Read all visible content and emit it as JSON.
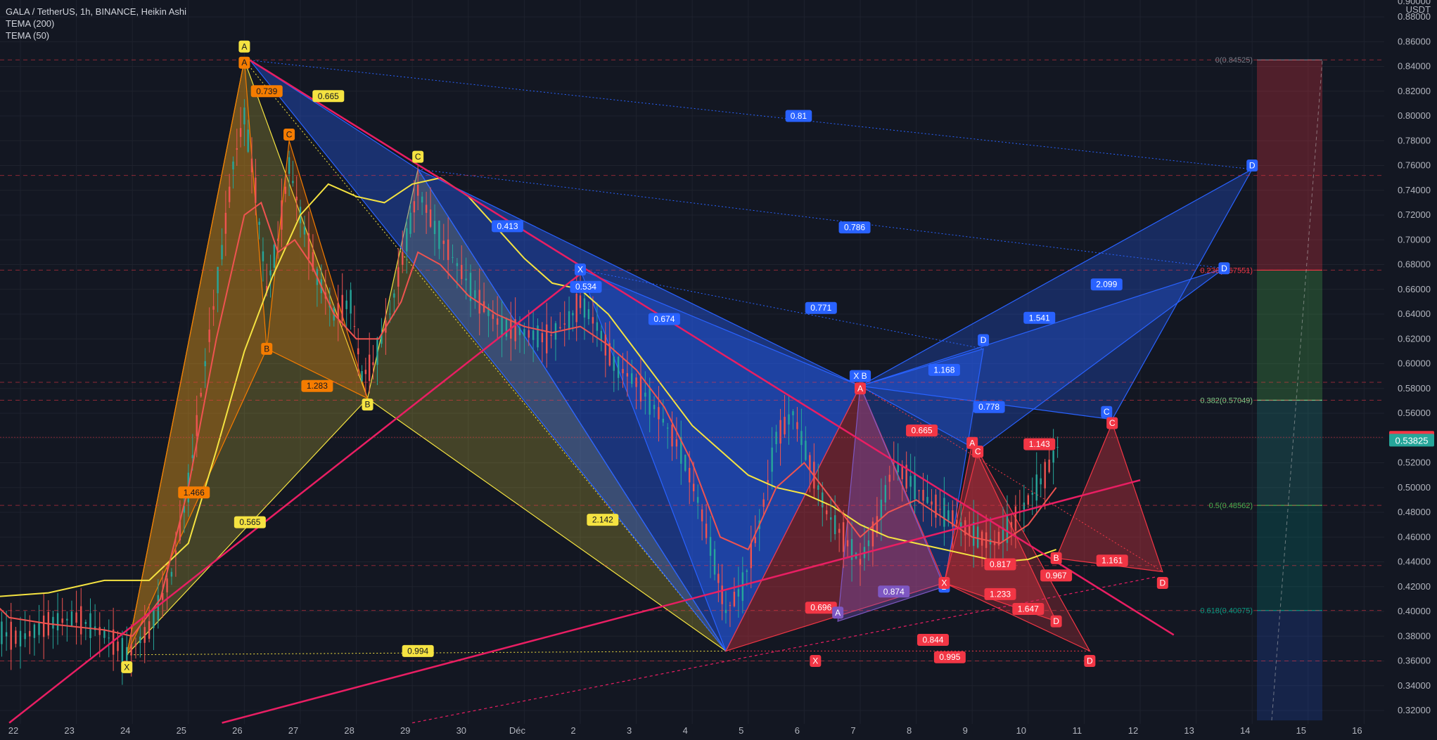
{
  "header": {
    "symbol_line": "GALA / TetherUS, 1h, BINANCE, Heikin Ashi",
    "indicators": [
      "TEMA (200)",
      "TEMA (50)"
    ]
  },
  "price_axis": {
    "unit": "USDT",
    "top_label": "0.90000",
    "ticks": [
      "0.88000",
      "0.86000",
      "0.84000",
      "0.82000",
      "0.80000",
      "0.78000",
      "0.76000",
      "0.74000",
      "0.72000",
      "0.70000",
      "0.68000",
      "0.66000",
      "0.64000",
      "0.62000",
      "0.60000",
      "0.58000",
      "0.56000",
      "0.54000",
      "0.52000",
      "0.50000",
      "0.48000",
      "0.46000",
      "0.44000",
      "0.42000",
      "0.40000",
      "0.38000",
      "0.36000",
      "0.34000",
      "0.32000"
    ],
    "current_price": "0.54060",
    "secondary_price": "0.53825",
    "current_price_color": "#f23645",
    "secondary_price_color": "#26a69a"
  },
  "time_axis": {
    "ticks": [
      "22",
      "23",
      "24",
      "25",
      "26",
      "27",
      "28",
      "29",
      "30",
      "Déc",
      "2",
      "3",
      "4",
      "5",
      "6",
      "7",
      "8",
      "9",
      "10",
      "11",
      "12",
      "13",
      "14",
      "15",
      "16"
    ]
  },
  "fib_levels": [
    {
      "label": "0(0.84525)",
      "price": 0.84525,
      "color": "#787b86"
    },
    {
      "label": "0.236(0.67551)",
      "price": 0.67551,
      "color": "#f23645"
    },
    {
      "label": "0.382(0.57049)",
      "price": 0.57049,
      "color": "#81c784"
    },
    {
      "label": "0.5(0.48562)",
      "price": 0.48562,
      "color": "#4caf50"
    },
    {
      "label": "0.618(0.40075)",
      "price": 0.40075,
      "color": "#089981"
    }
  ],
  "pattern_labels": {
    "yellow": [
      {
        "text": "A",
        "t": 26.0,
        "p": 0.856
      },
      {
        "text": "C",
        "t": 29.1,
        "p": 0.767
      },
      {
        "text": "B",
        "t": 28.2,
        "p": 0.567
      },
      {
        "text": "X",
        "t": 23.9,
        "p": 0.355
      },
      {
        "text": "0.665",
        "t": 27.5,
        "p": 0.816
      },
      {
        "text": "0.994",
        "t": 29.1,
        "p": 0.368
      },
      {
        "text": "2.142",
        "t": 32.4,
        "p": 0.474
      },
      {
        "text": "0.565",
        "t": 26.1,
        "p": 0.472
      }
    ],
    "orange": [
      {
        "text": "0.739",
        "t": 26.4,
        "p": 0.82
      },
      {
        "text": "C",
        "t": 26.8,
        "p": 0.785
      },
      {
        "text": "B",
        "t": 26.4,
        "p": 0.612
      },
      {
        "text": "1.283",
        "t": 27.3,
        "p": 0.582
      },
      {
        "text": "1.466",
        "t": 25.1,
        "p": 0.496
      },
      {
        "text": "A",
        "t": 26.0,
        "p": 0.843
      }
    ],
    "blue": [
      {
        "text": "0.81",
        "t": 35.9,
        "p": 0.8
      },
      {
        "text": "D",
        "t": 44.0,
        "p": 0.76
      },
      {
        "text": "0.413",
        "t": 30.7,
        "p": 0.711
      },
      {
        "text": "0.786",
        "t": 36.9,
        "p": 0.71
      },
      {
        "text": "D",
        "t": 43.5,
        "p": 0.677
      },
      {
        "text": "2.099",
        "t": 41.4,
        "p": 0.664
      },
      {
        "text": "X",
        "t": 32.0,
        "p": 0.676
      },
      {
        "text": "0.534",
        "t": 32.1,
        "p": 0.662
      },
      {
        "text": "0.674",
        "t": 33.5,
        "p": 0.636
      },
      {
        "text": "0.771",
        "t": 36.3,
        "p": 0.645
      },
      {
        "text": "1.541",
        "t": 40.2,
        "p": 0.637
      },
      {
        "text": "D",
        "t": 39.2,
        "p": 0.619
      },
      {
        "text": "X B",
        "t": 37.0,
        "p": 0.59
      },
      {
        "text": "1.168",
        "t": 38.5,
        "p": 0.595
      },
      {
        "text": "0.778",
        "t": 39.3,
        "p": 0.565
      },
      {
        "text": "C",
        "t": 41.4,
        "p": 0.561
      },
      {
        "text": "B",
        "t": 38.5,
        "p": 0.42
      }
    ],
    "red": [
      {
        "text": "A",
        "t": 37.0,
        "p": 0.58
      },
      {
        "text": "0.665",
        "t": 38.1,
        "p": 0.546
      },
      {
        "text": "A",
        "t": 39.0,
        "p": 0.536
      },
      {
        "text": "C",
        "t": 39.1,
        "p": 0.529
      },
      {
        "text": "1.143",
        "t": 40.2,
        "p": 0.535
      },
      {
        "text": "C",
        "t": 41.5,
        "p": 0.552
      },
      {
        "text": "X",
        "t": 38.5,
        "p": 0.423
      },
      {
        "text": "0.817",
        "t": 39.5,
        "p": 0.438
      },
      {
        "text": "B",
        "t": 40.5,
        "p": 0.443
      },
      {
        "text": "0.967",
        "t": 40.5,
        "p": 0.429
      },
      {
        "text": "1.161",
        "t": 41.5,
        "p": 0.441
      },
      {
        "text": "D",
        "t": 42.4,
        "p": 0.423
      },
      {
        "text": "1.233",
        "t": 39.5,
        "p": 0.414
      },
      {
        "text": "1.647",
        "t": 40.0,
        "p": 0.402
      },
      {
        "text": "D",
        "t": 40.5,
        "p": 0.392
      },
      {
        "text": "0.696",
        "t": 36.3,
        "p": 0.403
      },
      {
        "text": "0.844",
        "t": 38.3,
        "p": 0.377
      },
      {
        "text": "0.995",
        "t": 38.6,
        "p": 0.363
      },
      {
        "text": "D",
        "t": 41.1,
        "p": 0.36
      },
      {
        "text": "X",
        "t": 36.2,
        "p": 0.36
      }
    ],
    "purple": [
      {
        "text": "A",
        "t": 36.6,
        "p": 0.399
      },
      {
        "text": "0.874",
        "t": 37.6,
        "p": 0.416
      }
    ]
  },
  "colors": {
    "background": "#131722",
    "grid": "#1e222d",
    "up_candle": "#26a69a",
    "down_candle": "#ef5350",
    "tema200": "#f5e341",
    "tema50": "#ef5350",
    "trendline": "#e91e63",
    "harmonic_yellow": "#f5e341",
    "harmonic_orange": "#f57c00",
    "harmonic_blue": "#2962ff",
    "harmonic_red": "#f23645",
    "harmonic_purple": "#7e57c2"
  },
  "chart_data": {
    "type": "candlestick",
    "title": "GALA / TetherUS, 1h, BINANCE, Heikin Ashi",
    "xlabel": "",
    "ylabel": "USDT",
    "ylim": [
      0.31,
      0.9
    ],
    "x_ticks": [
      "22",
      "23",
      "24",
      "25",
      "26",
      "27",
      "28",
      "29",
      "30",
      "Déc",
      "2",
      "3",
      "4",
      "5",
      "6",
      "7",
      "8",
      "9",
      "10",
      "11",
      "12",
      "13",
      "14",
      "15",
      "16"
    ],
    "close_series": [
      {
        "t": 21.0,
        "p": 0.4
      },
      {
        "t": 21.5,
        "p": 0.385
      },
      {
        "t": 22.0,
        "p": 0.378
      },
      {
        "t": 22.5,
        "p": 0.39
      },
      {
        "t": 23.0,
        "p": 0.395
      },
      {
        "t": 23.5,
        "p": 0.382
      },
      {
        "t": 23.9,
        "p": 0.365
      },
      {
        "t": 24.3,
        "p": 0.385
      },
      {
        "t": 24.7,
        "p": 0.43
      },
      {
        "t": 25.0,
        "p": 0.5
      },
      {
        "t": 25.3,
        "p": 0.6
      },
      {
        "t": 25.6,
        "p": 0.69
      },
      {
        "t": 25.8,
        "p": 0.76
      },
      {
        "t": 26.0,
        "p": 0.8
      },
      {
        "t": 26.2,
        "p": 0.74
      },
      {
        "t": 26.4,
        "p": 0.66
      },
      {
        "t": 26.6,
        "p": 0.7
      },
      {
        "t": 26.8,
        "p": 0.76
      },
      {
        "t": 27.0,
        "p": 0.72
      },
      {
        "t": 27.3,
        "p": 0.67
      },
      {
        "t": 27.6,
        "p": 0.64
      },
      {
        "t": 27.9,
        "p": 0.65
      },
      {
        "t": 28.1,
        "p": 0.59
      },
      {
        "t": 28.3,
        "p": 0.6
      },
      {
        "t": 28.6,
        "p": 0.64
      },
      {
        "t": 28.9,
        "p": 0.7
      },
      {
        "t": 29.1,
        "p": 0.74
      },
      {
        "t": 29.4,
        "p": 0.71
      },
      {
        "t": 29.8,
        "p": 0.68
      },
      {
        "t": 30.2,
        "p": 0.65
      },
      {
        "t": 30.6,
        "p": 0.63
      },
      {
        "t": 31.0,
        "p": 0.625
      },
      {
        "t": 31.4,
        "p": 0.62
      },
      {
        "t": 31.8,
        "p": 0.635
      },
      {
        "t": 32.0,
        "p": 0.65
      },
      {
        "t": 32.3,
        "p": 0.63
      },
      {
        "t": 32.6,
        "p": 0.6
      },
      {
        "t": 33.0,
        "p": 0.585
      },
      {
        "t": 33.4,
        "p": 0.56
      },
      {
        "t": 33.8,
        "p": 0.53
      },
      {
        "t": 34.1,
        "p": 0.49
      },
      {
        "t": 34.4,
        "p": 0.44
      },
      {
        "t": 34.6,
        "p": 0.4
      },
      {
        "t": 34.9,
        "p": 0.42
      },
      {
        "t": 35.2,
        "p": 0.47
      },
      {
        "t": 35.5,
        "p": 0.54
      },
      {
        "t": 35.8,
        "p": 0.56
      },
      {
        "t": 36.1,
        "p": 0.52
      },
      {
        "t": 36.4,
        "p": 0.48
      },
      {
        "t": 36.7,
        "p": 0.46
      },
      {
        "t": 37.0,
        "p": 0.44
      },
      {
        "t": 37.3,
        "p": 0.47
      },
      {
        "t": 37.6,
        "p": 0.52
      },
      {
        "t": 37.9,
        "p": 0.505
      },
      {
        "t": 38.2,
        "p": 0.49
      },
      {
        "t": 38.5,
        "p": 0.48
      },
      {
        "t": 38.8,
        "p": 0.47
      },
      {
        "t": 39.1,
        "p": 0.46
      },
      {
        "t": 39.4,
        "p": 0.455
      },
      {
        "t": 39.7,
        "p": 0.47
      },
      {
        "t": 40.0,
        "p": 0.49
      },
      {
        "t": 40.3,
        "p": 0.51
      },
      {
        "t": 40.6,
        "p": 0.54
      }
    ],
    "tema200": [
      {
        "t": 21.0,
        "p": 0.41
      },
      {
        "t": 22.5,
        "p": 0.415
      },
      {
        "t": 23.5,
        "p": 0.425
      },
      {
        "t": 24.3,
        "p": 0.425
      },
      {
        "t": 25.0,
        "p": 0.455
      },
      {
        "t": 25.5,
        "p": 0.53
      },
      {
        "t": 26.0,
        "p": 0.61
      },
      {
        "t": 26.5,
        "p": 0.67
      },
      {
        "t": 27.0,
        "p": 0.72
      },
      {
        "t": 27.5,
        "p": 0.745
      },
      {
        "t": 28.0,
        "p": 0.735
      },
      {
        "t": 28.5,
        "p": 0.73
      },
      {
        "t": 29.0,
        "p": 0.745
      },
      {
        "t": 29.5,
        "p": 0.75
      },
      {
        "t": 30.0,
        "p": 0.735
      },
      {
        "t": 30.5,
        "p": 0.71
      },
      {
        "t": 31.0,
        "p": 0.685
      },
      {
        "t": 31.5,
        "p": 0.665
      },
      {
        "t": 32.0,
        "p": 0.66
      },
      {
        "t": 32.5,
        "p": 0.64
      },
      {
        "t": 33.0,
        "p": 0.61
      },
      {
        "t": 33.5,
        "p": 0.58
      },
      {
        "t": 34.0,
        "p": 0.55
      },
      {
        "t": 34.5,
        "p": 0.53
      },
      {
        "t": 35.0,
        "p": 0.51
      },
      {
        "t": 35.5,
        "p": 0.5
      },
      {
        "t": 36.0,
        "p": 0.495
      },
      {
        "t": 36.5,
        "p": 0.485
      },
      {
        "t": 37.0,
        "p": 0.47
      },
      {
        "t": 37.5,
        "p": 0.46
      },
      {
        "t": 38.0,
        "p": 0.455
      },
      {
        "t": 38.5,
        "p": 0.45
      },
      {
        "t": 39.0,
        "p": 0.445
      },
      {
        "t": 39.5,
        "p": 0.44
      },
      {
        "t": 40.0,
        "p": 0.442
      },
      {
        "t": 40.5,
        "p": 0.45
      }
    ],
    "tema50": [
      {
        "t": 21.0,
        "p": 0.43
      },
      {
        "t": 21.8,
        "p": 0.395
      },
      {
        "t": 22.5,
        "p": 0.39
      },
      {
        "t": 23.5,
        "p": 0.385
      },
      {
        "t": 24.0,
        "p": 0.38
      },
      {
        "t": 24.5,
        "p": 0.41
      },
      {
        "t": 25.0,
        "p": 0.5
      },
      {
        "t": 25.5,
        "p": 0.62
      },
      {
        "t": 26.0,
        "p": 0.72
      },
      {
        "t": 26.3,
        "p": 0.73
      },
      {
        "t": 26.6,
        "p": 0.69
      },
      {
        "t": 26.9,
        "p": 0.7
      },
      {
        "t": 27.2,
        "p": 0.68
      },
      {
        "t": 27.6,
        "p": 0.64
      },
      {
        "t": 28.0,
        "p": 0.62
      },
      {
        "t": 28.4,
        "p": 0.62
      },
      {
        "t": 28.8,
        "p": 0.65
      },
      {
        "t": 29.1,
        "p": 0.69
      },
      {
        "t": 29.5,
        "p": 0.68
      },
      {
        "t": 30.0,
        "p": 0.655
      },
      {
        "t": 30.5,
        "p": 0.64
      },
      {
        "t": 31.0,
        "p": 0.63
      },
      {
        "t": 31.5,
        "p": 0.625
      },
      {
        "t": 32.0,
        "p": 0.63
      },
      {
        "t": 32.5,
        "p": 0.615
      },
      {
        "t": 33.0,
        "p": 0.595
      },
      {
        "t": 33.5,
        "p": 0.565
      },
      {
        "t": 34.0,
        "p": 0.52
      },
      {
        "t": 34.5,
        "p": 0.46
      },
      {
        "t": 35.0,
        "p": 0.45
      },
      {
        "t": 35.5,
        "p": 0.5
      },
      {
        "t": 36.0,
        "p": 0.52
      },
      {
        "t": 36.5,
        "p": 0.49
      },
      {
        "t": 37.0,
        "p": 0.46
      },
      {
        "t": 37.5,
        "p": 0.48
      },
      {
        "t": 38.0,
        "p": 0.49
      },
      {
        "t": 38.5,
        "p": 0.475
      },
      {
        "t": 39.0,
        "p": 0.46
      },
      {
        "t": 39.5,
        "p": 0.455
      },
      {
        "t": 40.0,
        "p": 0.47
      },
      {
        "t": 40.5,
        "p": 0.5
      }
    ]
  }
}
